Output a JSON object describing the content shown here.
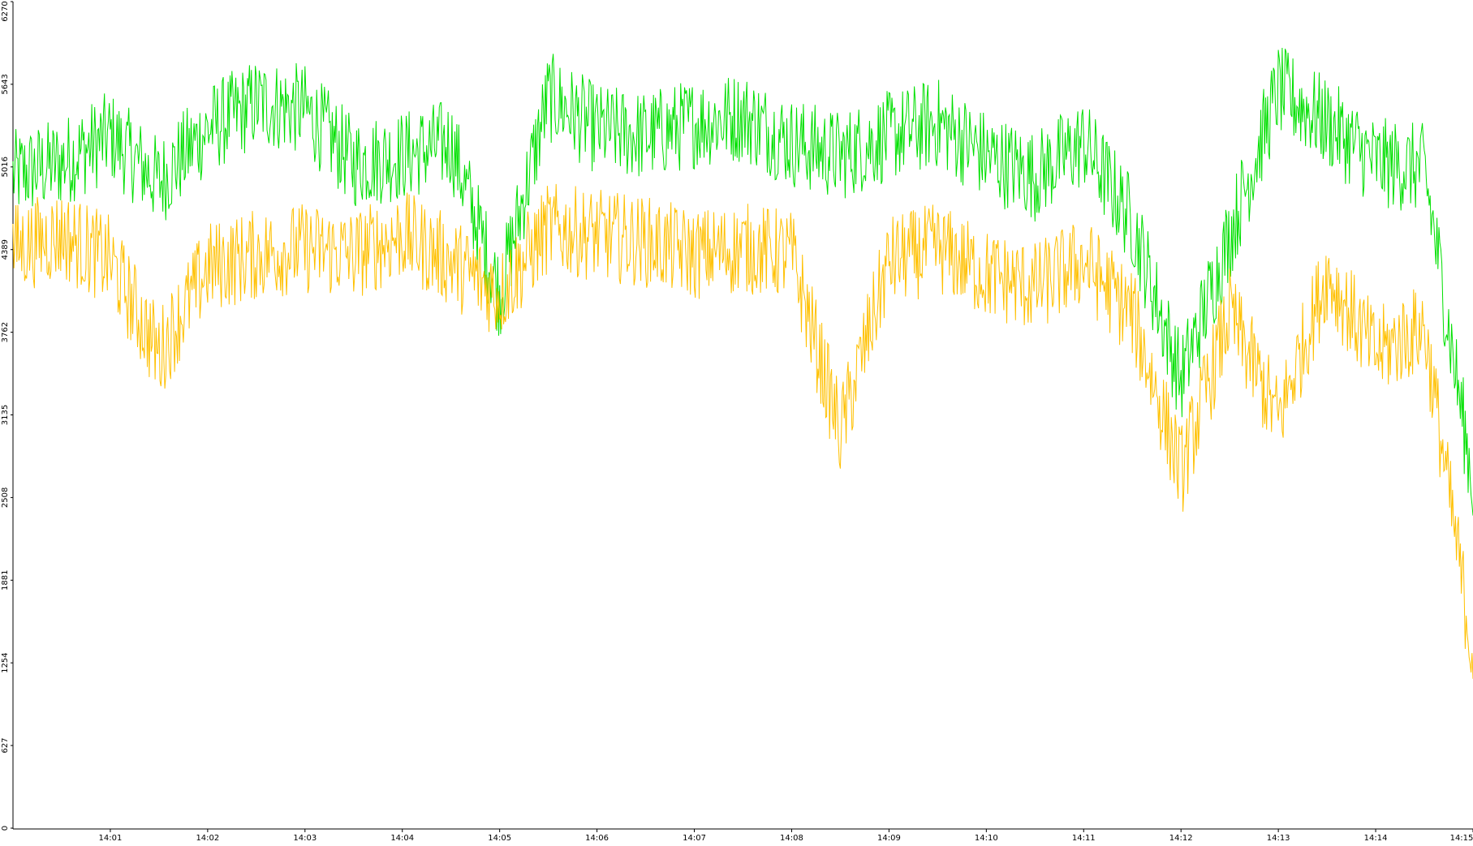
{
  "chart_data": {
    "type": "line",
    "title": "",
    "xlabel": "",
    "ylabel": "",
    "grid": false,
    "legend": "none",
    "ylim": [
      0,
      6270
    ],
    "yticks": [
      0,
      627,
      1254,
      1881,
      2508,
      3135,
      3762,
      4389,
      5016,
      5643,
      6270
    ],
    "xlim_minutes": [
      14.0,
      15.0
    ],
    "xtick_labels": [
      "14:01",
      "14:02",
      "14:03",
      "14:04",
      "14:05",
      "14:06",
      "14:07",
      "14:08",
      "14:09",
      "14:10",
      "14:11",
      "14:12",
      "14:13",
      "14:14",
      "14:15"
    ],
    "x_start": "14:00",
    "x_end": "14:15",
    "series": [
      {
        "color": "#00e000",
        "x": [
          "14:00",
          "14:00:30",
          "14:01",
          "14:01:30",
          "14:02",
          "14:02:30",
          "14:03",
          "14:03:30",
          "14:04",
          "14:04:30",
          "14:05",
          "14:05:30",
          "14:06",
          "14:06:30",
          "14:07",
          "14:07:30",
          "14:08",
          "14:08:30",
          "14:09",
          "14:09:30",
          "14:10",
          "14:10:30",
          "14:11",
          "14:11:30",
          "14:12",
          "14:12:30",
          "14:13",
          "14:13:30",
          "14:14",
          "14:14:30",
          "14:15"
        ],
        "values": [
          4950,
          5050,
          5250,
          4900,
          5300,
          5500,
          5450,
          5050,
          5100,
          5200,
          4050,
          5550,
          5300,
          5250,
          5350,
          5400,
          5200,
          5100,
          5250,
          5350,
          5100,
          4950,
          5200,
          4600,
          3400,
          4500,
          5600,
          5350,
          5050,
          5000,
          2600
        ]
      },
      {
        "color": "#ffc000",
        "x": [
          "14:00",
          "14:00:30",
          "14:01",
          "14:01:30",
          "14:02",
          "14:02:30",
          "14:03",
          "14:03:30",
          "14:04",
          "14:04:30",
          "14:05",
          "14:05:30",
          "14:06",
          "14:06:30",
          "14:07",
          "14:07:30",
          "14:08",
          "14:08:30",
          "14:09",
          "14:09:30",
          "14:10",
          "14:10:30",
          "14:11",
          "14:11:30",
          "14:12",
          "14:12:30",
          "14:13",
          "14:13:30",
          "14:14",
          "14:14:30",
          "14:15"
        ],
        "values": [
          4400,
          4500,
          4300,
          3600,
          4250,
          4350,
          4400,
          4350,
          4500,
          4300,
          4050,
          4550,
          4500,
          4450,
          4350,
          4400,
          4350,
          3000,
          4300,
          4400,
          4200,
          4100,
          4300,
          3900,
          2700,
          3900,
          3100,
          4200,
          3600,
          3800,
          1300
        ]
      }
    ]
  }
}
